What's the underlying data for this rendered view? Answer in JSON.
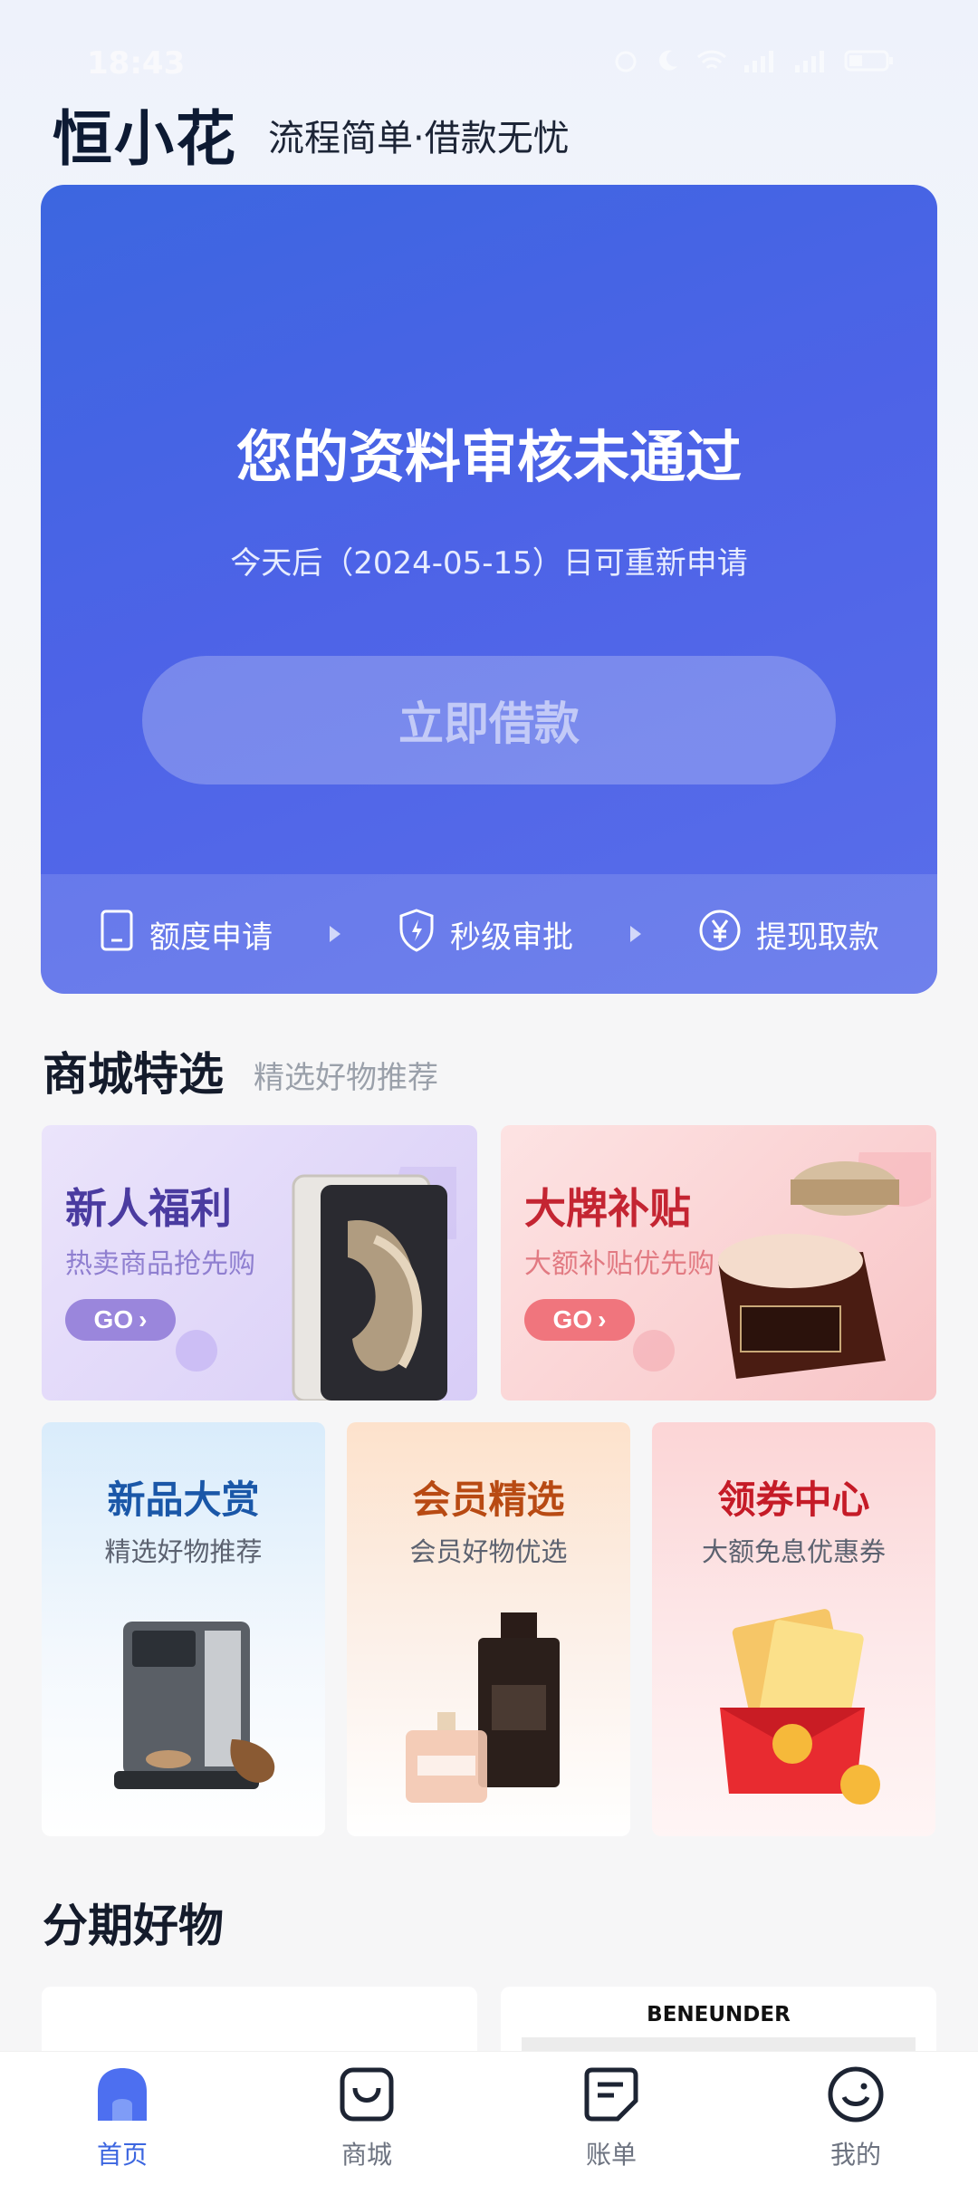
{
  "status_bar": {
    "time": "18:43"
  },
  "header": {
    "logo_text": "恒小花",
    "slogan": "流程简单·借款无忧"
  },
  "hero": {
    "title": "您的资料审核未通过",
    "subtitle": "今天后（2024-05-15）日可重新申请",
    "button_label": "立即借款",
    "steps": [
      {
        "label": "额度申请",
        "icon": "phone-icon"
      },
      {
        "label": "秒级审批",
        "icon": "shield-icon"
      },
      {
        "label": "提现取款",
        "icon": "yuan-icon"
      }
    ]
  },
  "mall_section": {
    "title": "商城特选",
    "subtitle": "精选好物推荐"
  },
  "promos": [
    {
      "title": "新人福利",
      "subtitle": "热卖商品抢先购",
      "button": "GO"
    },
    {
      "title": "大牌补贴",
      "subtitle": "大额补贴优先购",
      "button": "GO"
    }
  ],
  "mini_cards": [
    {
      "title": "新品大赏",
      "subtitle": "精选好物推荐"
    },
    {
      "title": "会员精选",
      "subtitle": "会员好物优选"
    },
    {
      "title": "领券中心",
      "subtitle": "大额免息优惠券"
    }
  ],
  "installment_section": {
    "title": "分期好物"
  },
  "products": [
    {
      "brand": ""
    },
    {
      "brand": "BENEUNDER"
    }
  ],
  "tab_bar": {
    "items": [
      {
        "label": "首页",
        "icon": "home-icon",
        "active": true
      },
      {
        "label": "商城",
        "icon": "shopping-bag-icon",
        "active": false
      },
      {
        "label": "账单",
        "icon": "bill-icon",
        "active": false
      },
      {
        "label": "我的",
        "icon": "profile-icon",
        "active": false
      }
    ]
  },
  "colors": {
    "accent": "#3c66e0",
    "hero_bg": "#4d63e7",
    "title_dark": "#141b2b"
  }
}
